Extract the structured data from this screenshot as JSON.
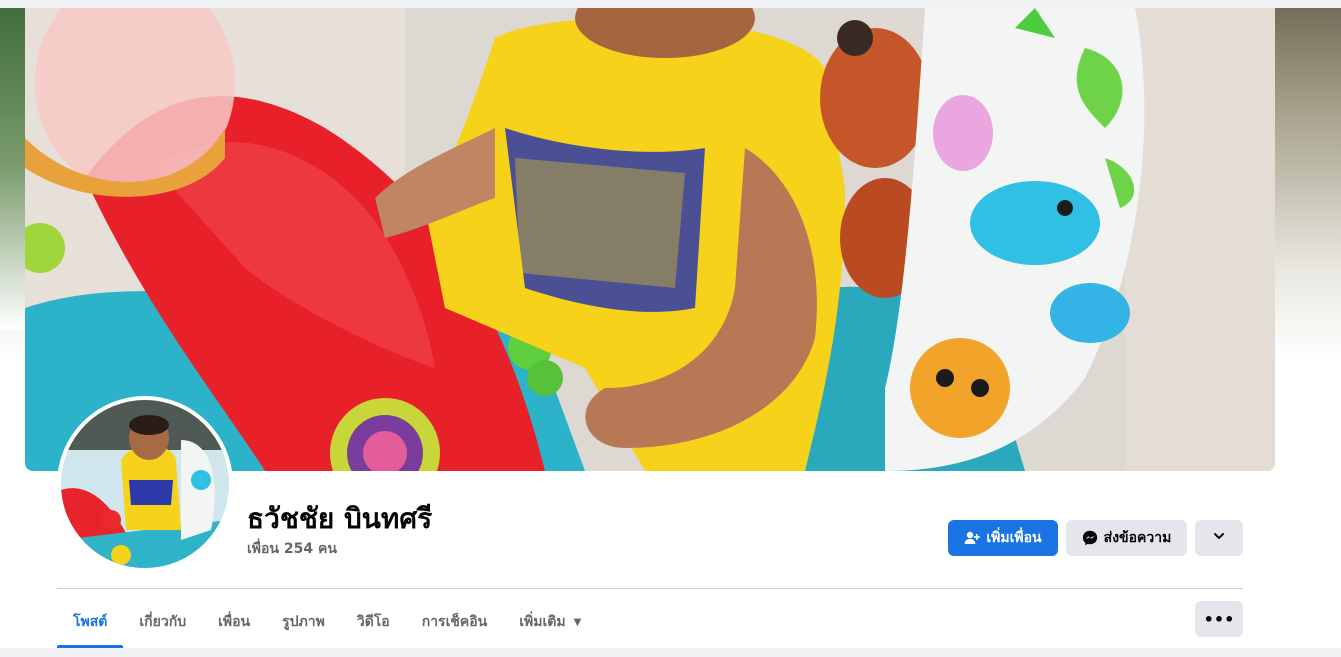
{
  "profile": {
    "name": "ธวัชชัย บินทศรี",
    "friends_text": "เพื่อน 254 คน"
  },
  "actions": {
    "add_friend_label": "เพิ่มเพื่อน",
    "message_label": "ส่งข้อความ",
    "more_icon": "chevron-down-icon"
  },
  "tabs": [
    {
      "label": "โพสต์",
      "active": true
    },
    {
      "label": "เกี่ยวกับ",
      "active": false
    },
    {
      "label": "เพื่อน",
      "active": false
    },
    {
      "label": "รูปภาพ",
      "active": false
    },
    {
      "label": "วิดีโอ",
      "active": false
    },
    {
      "label": "การเช็คอิน",
      "active": false
    },
    {
      "label": "เพิ่มเติม",
      "active": false
    }
  ],
  "tab_more_icon": "ellipsis-icon",
  "colors": {
    "accent": "#1b74e4",
    "secondary_button": "#e4e6eb",
    "muted_text": "#65676b"
  }
}
